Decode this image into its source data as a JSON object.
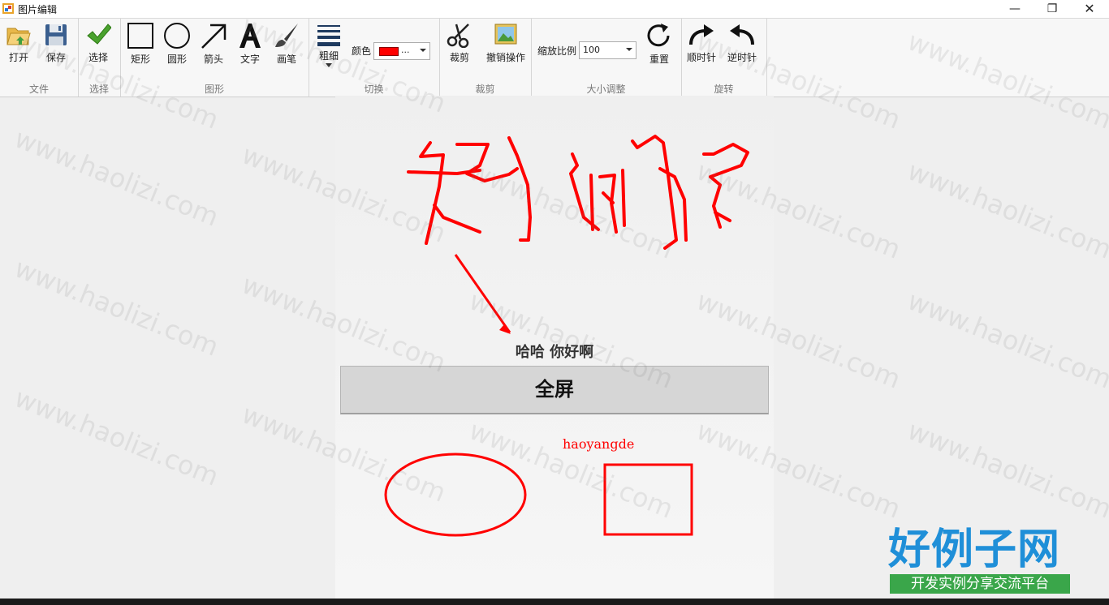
{
  "window": {
    "title": "图片编辑",
    "minimize": "—",
    "maximize": "❐",
    "close": "✕"
  },
  "ribbon": {
    "groups": {
      "file": "文件",
      "select": "选择",
      "shapes": "图形",
      "switch": "切换",
      "crop": "裁剪",
      "resize": "大小调整",
      "rotate": "旋转"
    },
    "tools": {
      "open": "打开",
      "save": "保存",
      "select": "选择",
      "rectangle": "矩形",
      "ellipse": "圆形",
      "arrow": "箭头",
      "text": "文字",
      "pen": "画笔",
      "thickness": "粗细",
      "crop": "裁剪",
      "undo": "撤销操作",
      "reset": "重置",
      "clockwise": "顺时针",
      "counterclockwise": "逆时针"
    },
    "color_label": "颜色",
    "color_value": "...",
    "color_hex": "#ff0000",
    "zoom_label": "缩放比例",
    "zoom_value": "100"
  },
  "canvas": {
    "phone_text": "哈哈 你好啊",
    "fullscreen_button": "全屏",
    "annotation_text": "haoyangde",
    "annotation_color": "#ff0000"
  },
  "watermark": {
    "text": "www.haolizi.com"
  },
  "brand": {
    "main": "好例子网",
    "sub": "开发实例分享交流平台"
  }
}
